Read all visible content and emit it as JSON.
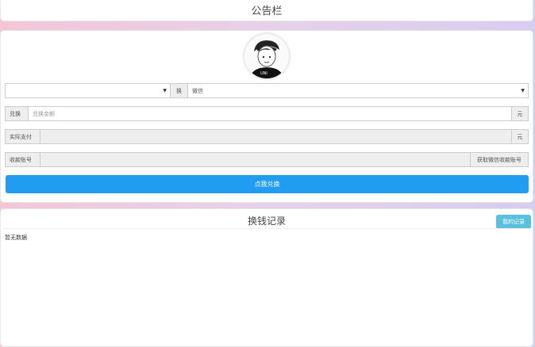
{
  "notice": {
    "title": "公告栏"
  },
  "exchange": {
    "convert_label": "换",
    "target_select_value": "微信",
    "redeem_addon": "兑换",
    "amount_placeholder": "兑换金额",
    "unit": "元",
    "actual_pay_addon": "实际支付",
    "account_addon": "收款账号",
    "get_account_button": "获取微信收款账号",
    "submit_label": "点我兑换"
  },
  "records": {
    "title": "换钱记录",
    "my_records_button": "我的记录",
    "empty_text": "暂无数据"
  }
}
